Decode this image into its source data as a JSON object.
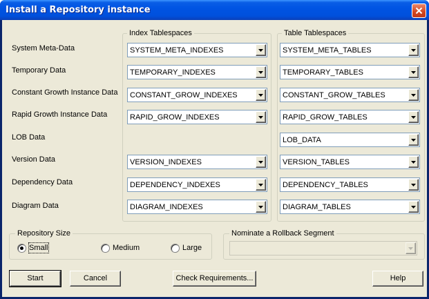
{
  "window": {
    "title": "Install a Repository instance"
  },
  "groups": {
    "index": "Index Tablespaces",
    "table": "Table Tablespaces",
    "size": "Repository Size",
    "rollback": "Nominate a Rollback Segment"
  },
  "rows": [
    {
      "label": "System Meta-Data",
      "index": "SYSTEM_META_INDEXES",
      "table": "SYSTEM_META_TABLES"
    },
    {
      "label": "Temporary Data",
      "index": "TEMPORARY_INDEXES",
      "table": "TEMPORARY_TABLES"
    },
    {
      "label": "Constant Growth Instance Data",
      "index": "CONSTANT_GROW_INDEXES",
      "table": "CONSTANT_GROW_TABLES"
    },
    {
      "label": "Rapid Growth Instance Data",
      "index": "RAPID_GROW_INDEXES",
      "table": "RAPID_GROW_TABLES"
    },
    {
      "label": "LOB Data",
      "index": null,
      "table": "LOB_DATA"
    },
    {
      "label": "Version Data",
      "index": "VERSION_INDEXES",
      "table": "VERSION_TABLES"
    },
    {
      "label": "Dependency Data",
      "index": "DEPENDENCY_INDEXES",
      "table": "DEPENDENCY_TABLES"
    },
    {
      "label": "Diagram Data",
      "index": "DIAGRAM_INDEXES",
      "table": "DIAGRAM_TABLES"
    }
  ],
  "size_options": {
    "small": "Small",
    "medium": "Medium",
    "large": "Large",
    "selected": "Small"
  },
  "rollback": {
    "value": ""
  },
  "buttons": {
    "start": "Start",
    "cancel": "Cancel",
    "check": "Check Requirements...",
    "help": "Help"
  },
  "icons": {
    "close": "close-icon",
    "dropdown": "chevron-down-icon"
  }
}
